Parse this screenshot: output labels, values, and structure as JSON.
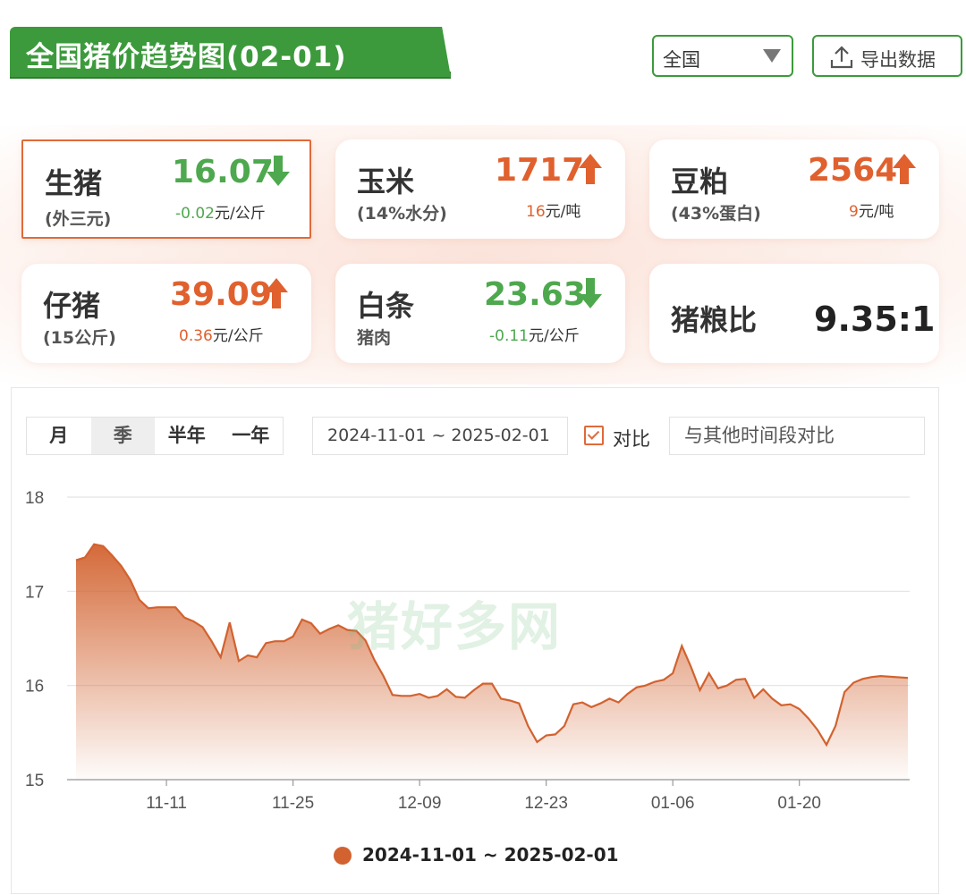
{
  "header": {
    "title": "全国猪价趋势图(02-01)",
    "region": "全国",
    "export_label": "导出数据"
  },
  "cards": [
    {
      "name": "生猪",
      "sub": "(外三元)",
      "price": "16.07",
      "direction": "down",
      "delta": "-0.02",
      "unit": "元/公斤"
    },
    {
      "name": "玉米",
      "sub": "(14%水分)",
      "price": "1717",
      "direction": "up",
      "delta": "16",
      "unit": "元/吨"
    },
    {
      "name": "豆粕",
      "sub": "(43%蛋白)",
      "price": "2564",
      "direction": "up",
      "delta": "9",
      "unit": "元/吨"
    },
    {
      "name": "仔猪",
      "sub": "(15公斤)",
      "price": "39.09",
      "direction": "up",
      "delta": "0.36",
      "unit": "元/公斤"
    },
    {
      "name": "白条",
      "sub": "猪肉",
      "price": "23.63",
      "direction": "down",
      "delta": "-0.11",
      "unit": "元/公斤"
    },
    {
      "name": "猪粮比",
      "ratio": "9.35:1"
    }
  ],
  "chart_panel": {
    "tabs": [
      "月",
      "季",
      "半年",
      "一年"
    ],
    "active_tab": "季",
    "date_range": "2024-11-01 ~ 2025-02-01",
    "compare_label": "对比",
    "compare_placeholder": "与其他时间段对比",
    "watermark": "猪好多网"
  },
  "colors": {
    "brand_green": "#3c9a3c",
    "up_orange": "#e0602e",
    "down_green": "#4ea84e",
    "series": "#d2622f"
  },
  "chart_data": {
    "type": "area",
    "title": "",
    "xlabel": "",
    "ylabel": "",
    "ylim": [
      15,
      18
    ],
    "yticks": [
      15,
      16,
      17,
      18
    ],
    "xticks": [
      "11-11",
      "11-25",
      "12-09",
      "12-23",
      "01-06",
      "01-20"
    ],
    "grid": true,
    "legend": "bottom-center",
    "series": [
      {
        "name": "2024-11-01 ~ 2025-02-01",
        "x": [
          "2024-11-01",
          "2024-11-02",
          "2024-11-03",
          "2024-11-04",
          "2024-11-05",
          "2024-11-06",
          "2024-11-07",
          "2024-11-08",
          "2024-11-09",
          "2024-11-10",
          "2024-11-11",
          "2024-11-12",
          "2024-11-13",
          "2024-11-14",
          "2024-11-15",
          "2024-11-16",
          "2024-11-17",
          "2024-11-18",
          "2024-11-19",
          "2024-11-20",
          "2024-11-21",
          "2024-11-22",
          "2024-11-23",
          "2024-11-24",
          "2024-11-25",
          "2024-11-26",
          "2024-11-27",
          "2024-11-28",
          "2024-11-29",
          "2024-11-30",
          "2024-12-01",
          "2024-12-02",
          "2024-12-03",
          "2024-12-04",
          "2024-12-05",
          "2024-12-06",
          "2024-12-07",
          "2024-12-08",
          "2024-12-09",
          "2024-12-10",
          "2024-12-11",
          "2024-12-12",
          "2024-12-13",
          "2024-12-14",
          "2024-12-15",
          "2024-12-16",
          "2024-12-17",
          "2024-12-18",
          "2024-12-19",
          "2024-12-20",
          "2024-12-21",
          "2024-12-22",
          "2024-12-23",
          "2024-12-24",
          "2024-12-25",
          "2024-12-26",
          "2024-12-27",
          "2024-12-28",
          "2024-12-29",
          "2024-12-30",
          "2024-12-31",
          "2025-01-01",
          "2025-01-02",
          "2025-01-03",
          "2025-01-04",
          "2025-01-05",
          "2025-01-06",
          "2025-01-07",
          "2025-01-08",
          "2025-01-09",
          "2025-01-10",
          "2025-01-11",
          "2025-01-12",
          "2025-01-13",
          "2025-01-14",
          "2025-01-15",
          "2025-01-16",
          "2025-01-17",
          "2025-01-18",
          "2025-01-19",
          "2025-01-20",
          "2025-01-21",
          "2025-01-22",
          "2025-01-23",
          "2025-01-24",
          "2025-01-25",
          "2025-01-26",
          "2025-01-27",
          "2025-01-28",
          "2025-01-29",
          "2025-02-01"
        ],
        "values": [
          17.33,
          17.36,
          17.5,
          17.48,
          17.38,
          17.27,
          17.12,
          16.91,
          16.82,
          16.83,
          16.83,
          16.83,
          16.72,
          16.68,
          16.62,
          16.47,
          16.3,
          16.67,
          16.26,
          16.32,
          16.3,
          16.45,
          16.47,
          16.47,
          16.52,
          16.7,
          16.66,
          16.55,
          16.6,
          16.64,
          16.59,
          16.58,
          16.48,
          16.27,
          16.1,
          15.9,
          15.89,
          15.89,
          15.91,
          15.87,
          15.89,
          15.96,
          15.88,
          15.87,
          15.95,
          16.02,
          16.02,
          15.86,
          15.84,
          15.81,
          15.57,
          15.4,
          15.47,
          15.48,
          15.57,
          15.8,
          15.82,
          15.77,
          15.81,
          15.86,
          15.82,
          15.91,
          15.98,
          16.0,
          16.04,
          16.06,
          16.13,
          16.42,
          16.2,
          15.95,
          16.13,
          15.97,
          16.0,
          16.06,
          16.07,
          15.87,
          15.96,
          15.86,
          15.79,
          15.8,
          15.75,
          15.65,
          15.53,
          15.37,
          15.57,
          15.93,
          16.03,
          16.07,
          16.09,
          16.1,
          16.08
        ]
      }
    ]
  }
}
